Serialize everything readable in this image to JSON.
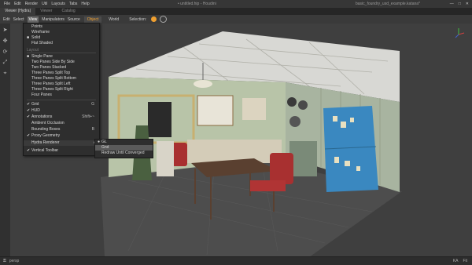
{
  "menubar": [
    "File",
    "Edit",
    "Render",
    "Util",
    "Layouts",
    "Tabs",
    "Help"
  ],
  "window_title": "• untitled.hip - Houdini",
  "scene_title": "basic_foundry_usd_example.katana*",
  "tabs": [
    "Viewer (Hydra)",
    "Viewer",
    "Catalog"
  ],
  "subbar": {
    "menus": [
      "Edit",
      "Select",
      "View",
      "Manipulators",
      "Source"
    ],
    "selected_menu": "View",
    "object_button": "Object",
    "world_button": "World",
    "selection_label": "Selection:"
  },
  "dropdown": {
    "shading_items": [
      {
        "label": "Points",
        "checked": false
      },
      {
        "label": "Wireframe",
        "checked": false
      },
      {
        "label": "Solid",
        "checked": true
      },
      {
        "label": "Flat Shaded",
        "checked": false
      }
    ],
    "layout_section": "Layout",
    "layout_items": [
      {
        "label": "Single Pane",
        "checked": true
      },
      {
        "label": "Two Panes Side By Side",
        "checked": false
      },
      {
        "label": "Two Panes Stacked",
        "checked": false
      },
      {
        "label": "Three Panes Split Top",
        "checked": false
      },
      {
        "label": "Three Panes Split Bottom",
        "checked": false
      },
      {
        "label": "Three Panes Split Left",
        "checked": false
      },
      {
        "label": "Three Panes Split Right",
        "checked": false
      },
      {
        "label": "Four Panes",
        "checked": false
      }
    ],
    "display_items": [
      {
        "label": "Grid",
        "checked": true,
        "shortcut": "G"
      },
      {
        "label": "HUD",
        "checked": true,
        "shortcut": ""
      },
      {
        "label": "Annotations",
        "checked": true,
        "shortcut": "Shift+~"
      },
      {
        "label": "Ambient Occlusion",
        "checked": false,
        "shortcut": ""
      },
      {
        "label": "Bounding Boxes",
        "checked": false,
        "shortcut": "B"
      },
      {
        "label": "Proxy Geometry",
        "checked": true,
        "shortcut": ""
      }
    ],
    "hydra_renderer": "Hydra Renderer",
    "toolbar_item": {
      "label": "Vertical Toolbar",
      "checked": true
    }
  },
  "submenu": {
    "items": [
      {
        "label": "GL",
        "checked": true
      },
      {
        "label": "Gnd",
        "checked": false,
        "selected": true
      },
      {
        "label": "Redraw Until Converged",
        "checked": false
      }
    ]
  },
  "status": {
    "camera": "persp",
    "zoom": "Fit",
    "mode": "KA"
  },
  "colors": {
    "accent": "#f0a030",
    "fridge": "#3a88c0",
    "walls": "#b8c4a8",
    "chair_red": "#a83030"
  },
  "icons": [
    "arrow-select-icon",
    "move-icon",
    "rotate-icon",
    "scale-icon",
    "camera-icon"
  ]
}
